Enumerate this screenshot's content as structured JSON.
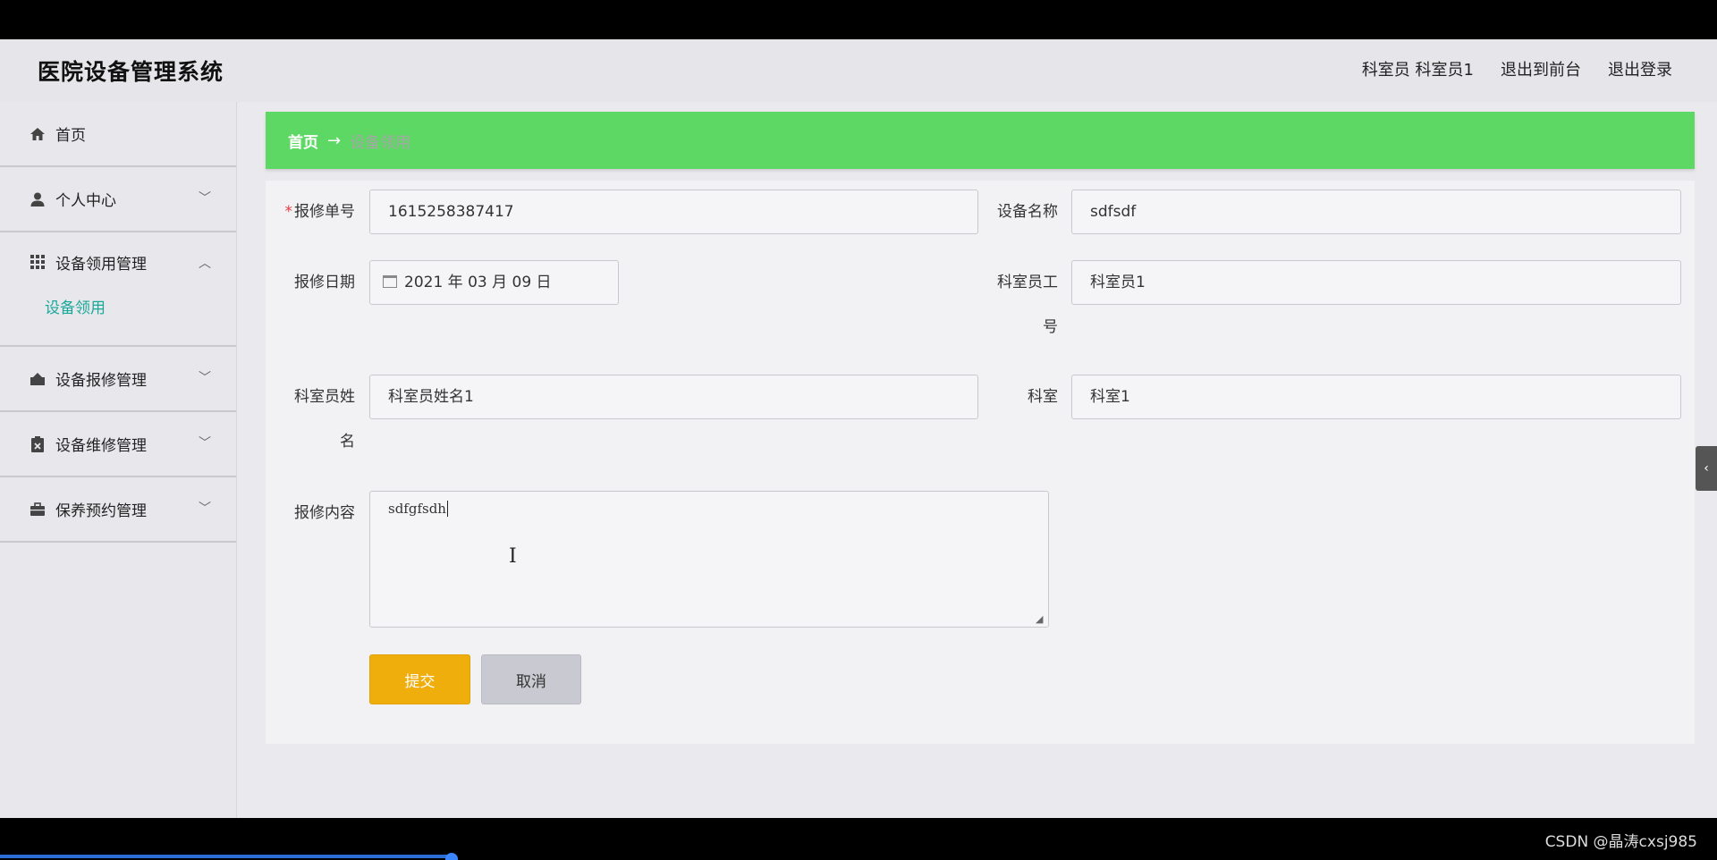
{
  "header": {
    "title": "医院设备管理系统",
    "user": "科室员 科室员1",
    "to_front": "退出到前台",
    "logout": "退出登录"
  },
  "sidebar": {
    "items": [
      {
        "label": "首页",
        "icon": "home-icon"
      },
      {
        "label": "个人中心",
        "icon": "user-icon"
      },
      {
        "label": "设备领用管理",
        "icon": "grid-icon",
        "open": true,
        "children": [
          {
            "label": "设备领用",
            "active": true
          }
        ]
      },
      {
        "label": "设备报修管理",
        "icon": "bank-icon"
      },
      {
        "label": "设备维修管理",
        "icon": "clipboard-icon"
      },
      {
        "label": "保养预约管理",
        "icon": "briefcase-icon"
      }
    ]
  },
  "breadcrumb": {
    "home": "首页",
    "arrow": "→",
    "current": "设备领用"
  },
  "form": {
    "repair_no_label": "报修单号",
    "repair_no_required": "*",
    "repair_no_value": "1615258387417",
    "device_name_label": "设备名称",
    "device_name_value": "sdfsdf",
    "repair_date_label": "报修日期",
    "repair_date_value": "2021 年 03 月 09 日",
    "staff_no_label_1": "科室员工",
    "staff_no_label_2": "号",
    "staff_no_value": "科室员1",
    "staff_name_label_1": "科室员姓",
    "staff_name_label_2": "名",
    "staff_name_value": "科室员姓名1",
    "dept_label": "科室",
    "dept_value": "科室1",
    "content_label": "报修内容",
    "content_value": "sdfgfsdh",
    "submit_label": "提交",
    "cancel_label": "取消"
  },
  "colors": {
    "breadcrumb_bg": "#5ed865",
    "submit_bg": "#efae0c",
    "active_menu": "#1aa89a"
  },
  "watermark": "CSDN @晶涛cxsj985"
}
